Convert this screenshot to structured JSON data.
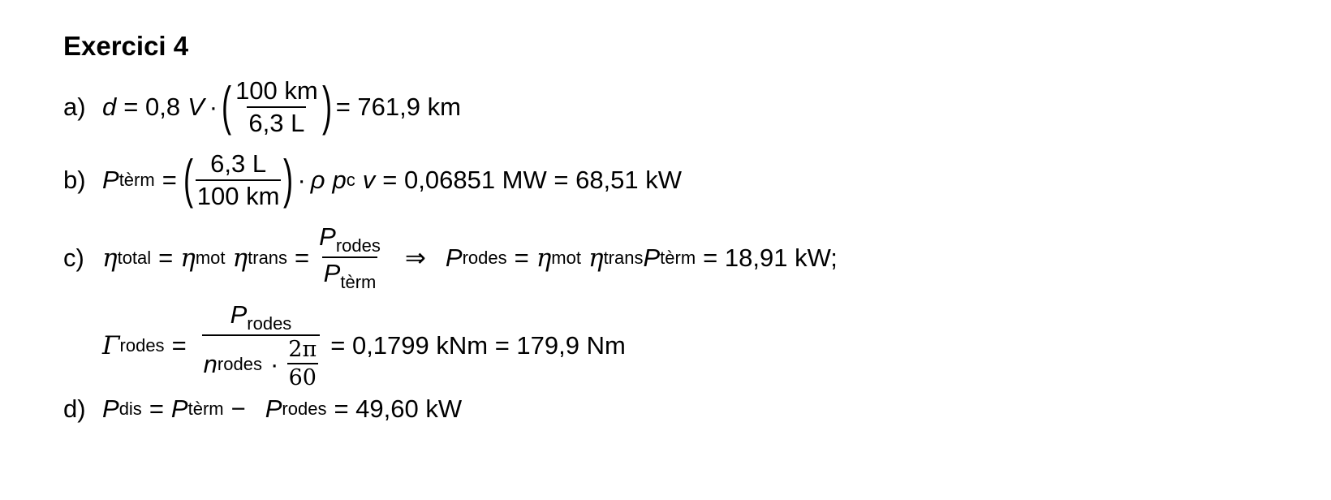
{
  "title": "Exercici 4",
  "a": {
    "label": "a)",
    "var": "d",
    "eq_coef": "= 0,8",
    "V": "V",
    "dot": "·",
    "num": "100 km",
    "den": "6,3 L",
    "result": "= 761,9 km"
  },
  "b": {
    "label": "b)",
    "P": "P",
    "sub": "tèrm",
    "eq": "=",
    "num": "6,3 L",
    "den": "100 km",
    "rest_dot": "·",
    "rho": "ρ",
    "p": "p",
    "p_sub": "c",
    "v": "v",
    "result": "= 0,06851 MW = 68,51 kW"
  },
  "c": {
    "label": "c)",
    "eta": "η",
    "sub_total": "total",
    "sub_mot": "mot",
    "sub_trans": "trans",
    "eq": "=",
    "P": "P",
    "sub_rodes": "rodes",
    "sub_term": "tèrm",
    "implies": "⇒",
    "result": "= 18,91 kW;"
  },
  "c2": {
    "gamma": "Γ",
    "sub_rodes": "rodes",
    "eq": "=",
    "P": "P",
    "n": "n",
    "dot": "·",
    "twopi": "2π",
    "sixty": "60",
    "result": "= 0,1799 kNm = 179,9 Nm"
  },
  "d": {
    "label": "d)",
    "P": "P",
    "sub_dis": "dis",
    "eq": "=",
    "sub_term": "tèrm",
    "minus": "−",
    "sub_rodes": "rodes",
    "result": "= 49,60 kW"
  }
}
